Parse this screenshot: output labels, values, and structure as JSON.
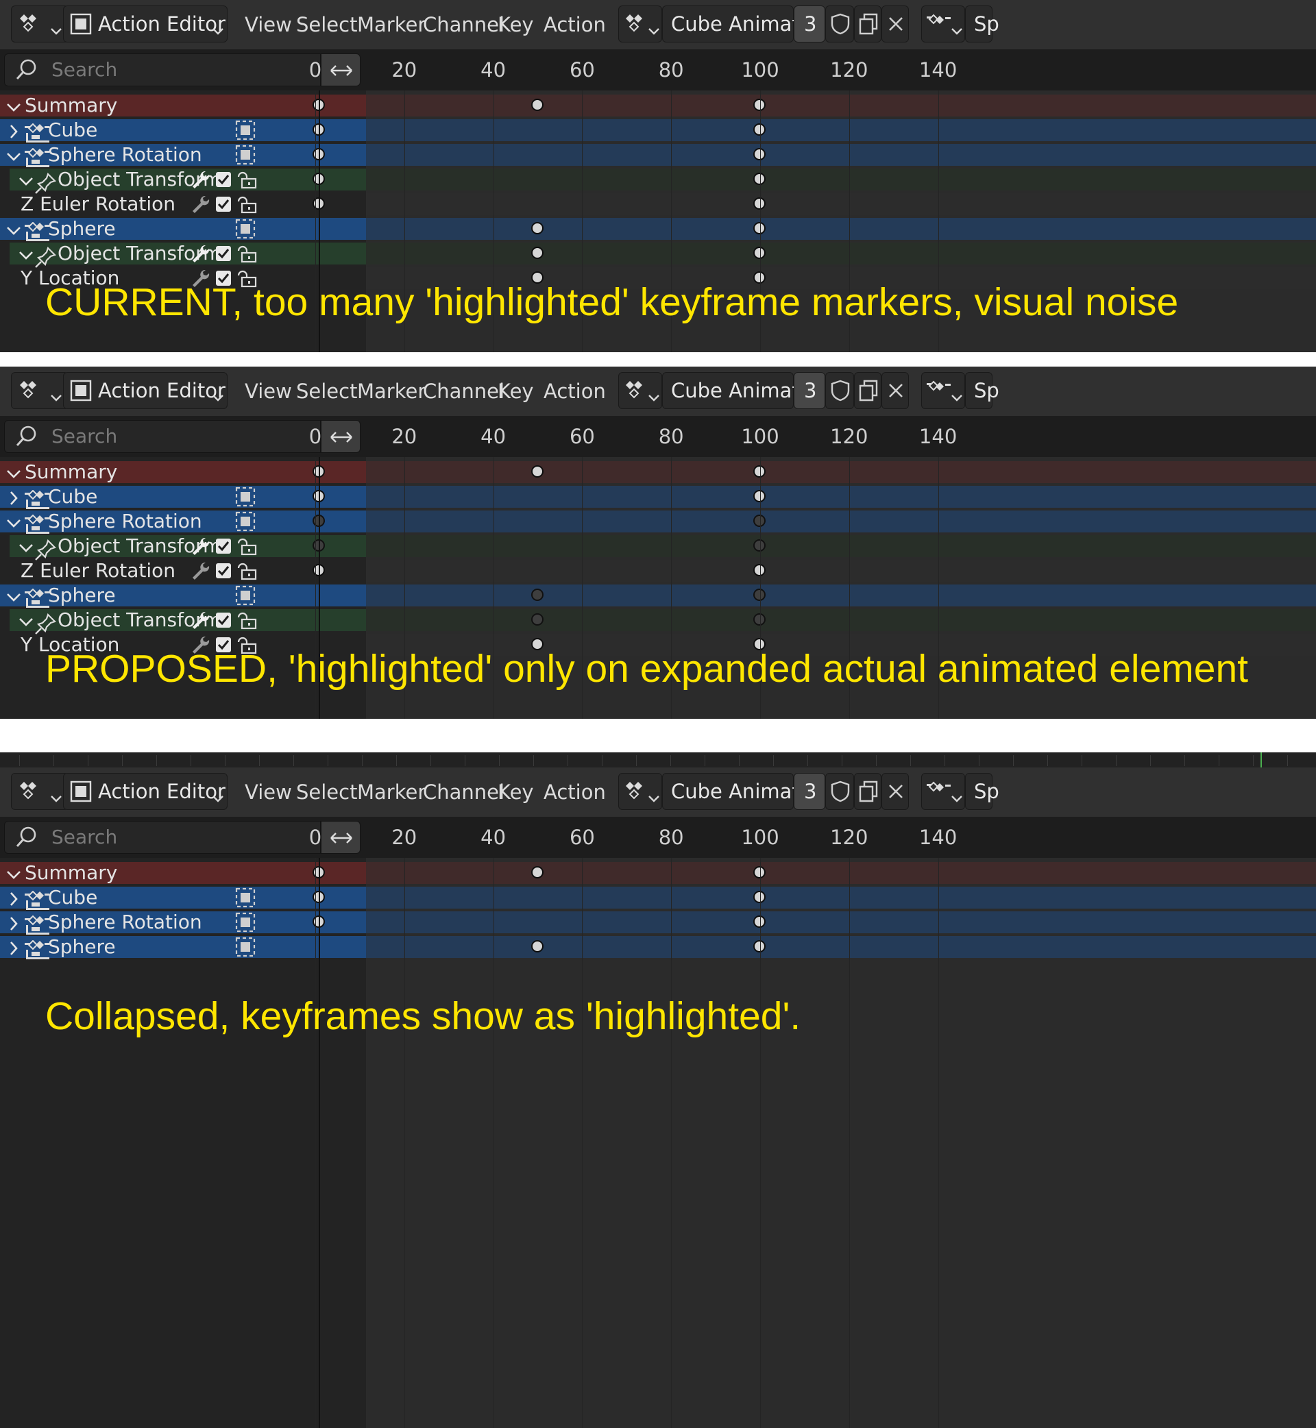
{
  "header": {
    "editor_mode": "Action Editor",
    "menus": [
      "View",
      "Select",
      "Marker",
      "Channel",
      "Key",
      "Action"
    ],
    "action_name": "Cube Animations",
    "users_count": "3",
    "cutoff_label": "Sp"
  },
  "search": {
    "placeholder": "Search"
  },
  "frame_ticks": [
    "0",
    "20",
    "40",
    "60",
    "80",
    "100",
    "120",
    "140"
  ],
  "panels": [
    {
      "caption": "CURRENT, too many 'highlighted' keyframe markers, visual noise",
      "rows": [
        {
          "label": "Summary",
          "kind": "summary",
          "expanded": true,
          "keys": [
            {
              "frame": 1,
              "style": "highlighted"
            },
            {
              "frame": 50,
              "style": "highlighted"
            },
            {
              "frame": 100,
              "style": "highlighted"
            }
          ]
        },
        {
          "label": "Cube",
          "kind": "object",
          "expanded": false,
          "keys": [
            {
              "frame": 1,
              "style": "highlighted"
            },
            {
              "frame": 100,
              "style": "highlighted"
            }
          ]
        },
        {
          "label": "Sphere Rotation",
          "kind": "object",
          "expanded": true,
          "keys": [
            {
              "frame": 1,
              "style": "highlighted"
            },
            {
              "frame": 100,
              "style": "highlighted"
            }
          ]
        },
        {
          "label": "Object Transforms",
          "kind": "group",
          "expanded": true,
          "keys": [
            {
              "frame": 1,
              "style": "highlighted"
            },
            {
              "frame": 100,
              "style": "highlighted"
            }
          ]
        },
        {
          "label": "Z Euler Rotation",
          "kind": "fcurve",
          "keys": [
            {
              "frame": 1,
              "style": "highlighted"
            },
            {
              "frame": 100,
              "style": "highlighted"
            }
          ]
        },
        {
          "label": "Sphere",
          "kind": "object",
          "expanded": true,
          "keys": [
            {
              "frame": 50,
              "style": "highlighted"
            },
            {
              "frame": 100,
              "style": "highlighted"
            }
          ]
        },
        {
          "label": "Object Transforms",
          "kind": "group",
          "expanded": true,
          "keys": [
            {
              "frame": 50,
              "style": "highlighted"
            },
            {
              "frame": 100,
              "style": "highlighted"
            }
          ]
        },
        {
          "label": "Y Location",
          "kind": "fcurve",
          "keys": [
            {
              "frame": 50,
              "style": "highlighted"
            },
            {
              "frame": 100,
              "style": "highlighted"
            }
          ]
        }
      ]
    },
    {
      "caption": "PROPOSED, 'highlighted' only on expanded actual animated element",
      "rows": [
        {
          "label": "Summary",
          "kind": "summary",
          "expanded": true,
          "keys": [
            {
              "frame": 1,
              "style": "highlighted"
            },
            {
              "frame": 50,
              "style": "highlighted"
            },
            {
              "frame": 100,
              "style": "highlighted"
            }
          ]
        },
        {
          "label": "Cube",
          "kind": "object",
          "expanded": false,
          "keys": [
            {
              "frame": 1,
              "style": "highlighted"
            },
            {
              "frame": 100,
              "style": "highlighted"
            }
          ]
        },
        {
          "label": "Sphere Rotation",
          "kind": "object",
          "expanded": true,
          "keys": [
            {
              "frame": 1,
              "style": "dim"
            },
            {
              "frame": 100,
              "style": "dim"
            }
          ]
        },
        {
          "label": "Object Transforms",
          "kind": "group",
          "expanded": true,
          "keys": [
            {
              "frame": 1,
              "style": "dim"
            },
            {
              "frame": 100,
              "style": "dim"
            }
          ]
        },
        {
          "label": "Z Euler Rotation",
          "kind": "fcurve",
          "keys": [
            {
              "frame": 1,
              "style": "highlighted"
            },
            {
              "frame": 100,
              "style": "highlighted"
            }
          ]
        },
        {
          "label": "Sphere",
          "kind": "object",
          "expanded": true,
          "keys": [
            {
              "frame": 50,
              "style": "dim"
            },
            {
              "frame": 100,
              "style": "dim"
            }
          ]
        },
        {
          "label": "Object Transforms",
          "kind": "group",
          "expanded": true,
          "keys": [
            {
              "frame": 50,
              "style": "dim"
            },
            {
              "frame": 100,
              "style": "dim"
            }
          ]
        },
        {
          "label": "Y Location",
          "kind": "fcurve",
          "keys": [
            {
              "frame": 50,
              "style": "highlighted"
            },
            {
              "frame": 100,
              "style": "highlighted"
            }
          ]
        }
      ]
    },
    {
      "caption": "Collapsed, keyframes show as 'highlighted'.",
      "rows": [
        {
          "label": "Summary",
          "kind": "summary",
          "expanded": true,
          "keys": [
            {
              "frame": 1,
              "style": "highlighted"
            },
            {
              "frame": 50,
              "style": "highlighted"
            },
            {
              "frame": 100,
              "style": "highlighted"
            }
          ]
        },
        {
          "label": "Cube",
          "kind": "object",
          "expanded": false,
          "keys": [
            {
              "frame": 1,
              "style": "highlighted"
            },
            {
              "frame": 100,
              "style": "highlighted"
            }
          ]
        },
        {
          "label": "Sphere Rotation",
          "kind": "object",
          "expanded": false,
          "keys": [
            {
              "frame": 1,
              "style": "highlighted"
            },
            {
              "frame": 100,
              "style": "highlighted"
            }
          ]
        },
        {
          "label": "Sphere",
          "kind": "object",
          "expanded": false,
          "keys": [
            {
              "frame": 50,
              "style": "highlighted"
            },
            {
              "frame": 100,
              "style": "highlighted"
            }
          ]
        }
      ]
    }
  ],
  "colors": {
    "summary_row": "#4e2a2a",
    "object_row": "#1f4677",
    "group_row": "#263226",
    "fcurve_row": "#2e2e2e",
    "caption": "#ffe600",
    "key_highlighted": "#d6d6d6",
    "key_dim": "#3e3e3e"
  }
}
